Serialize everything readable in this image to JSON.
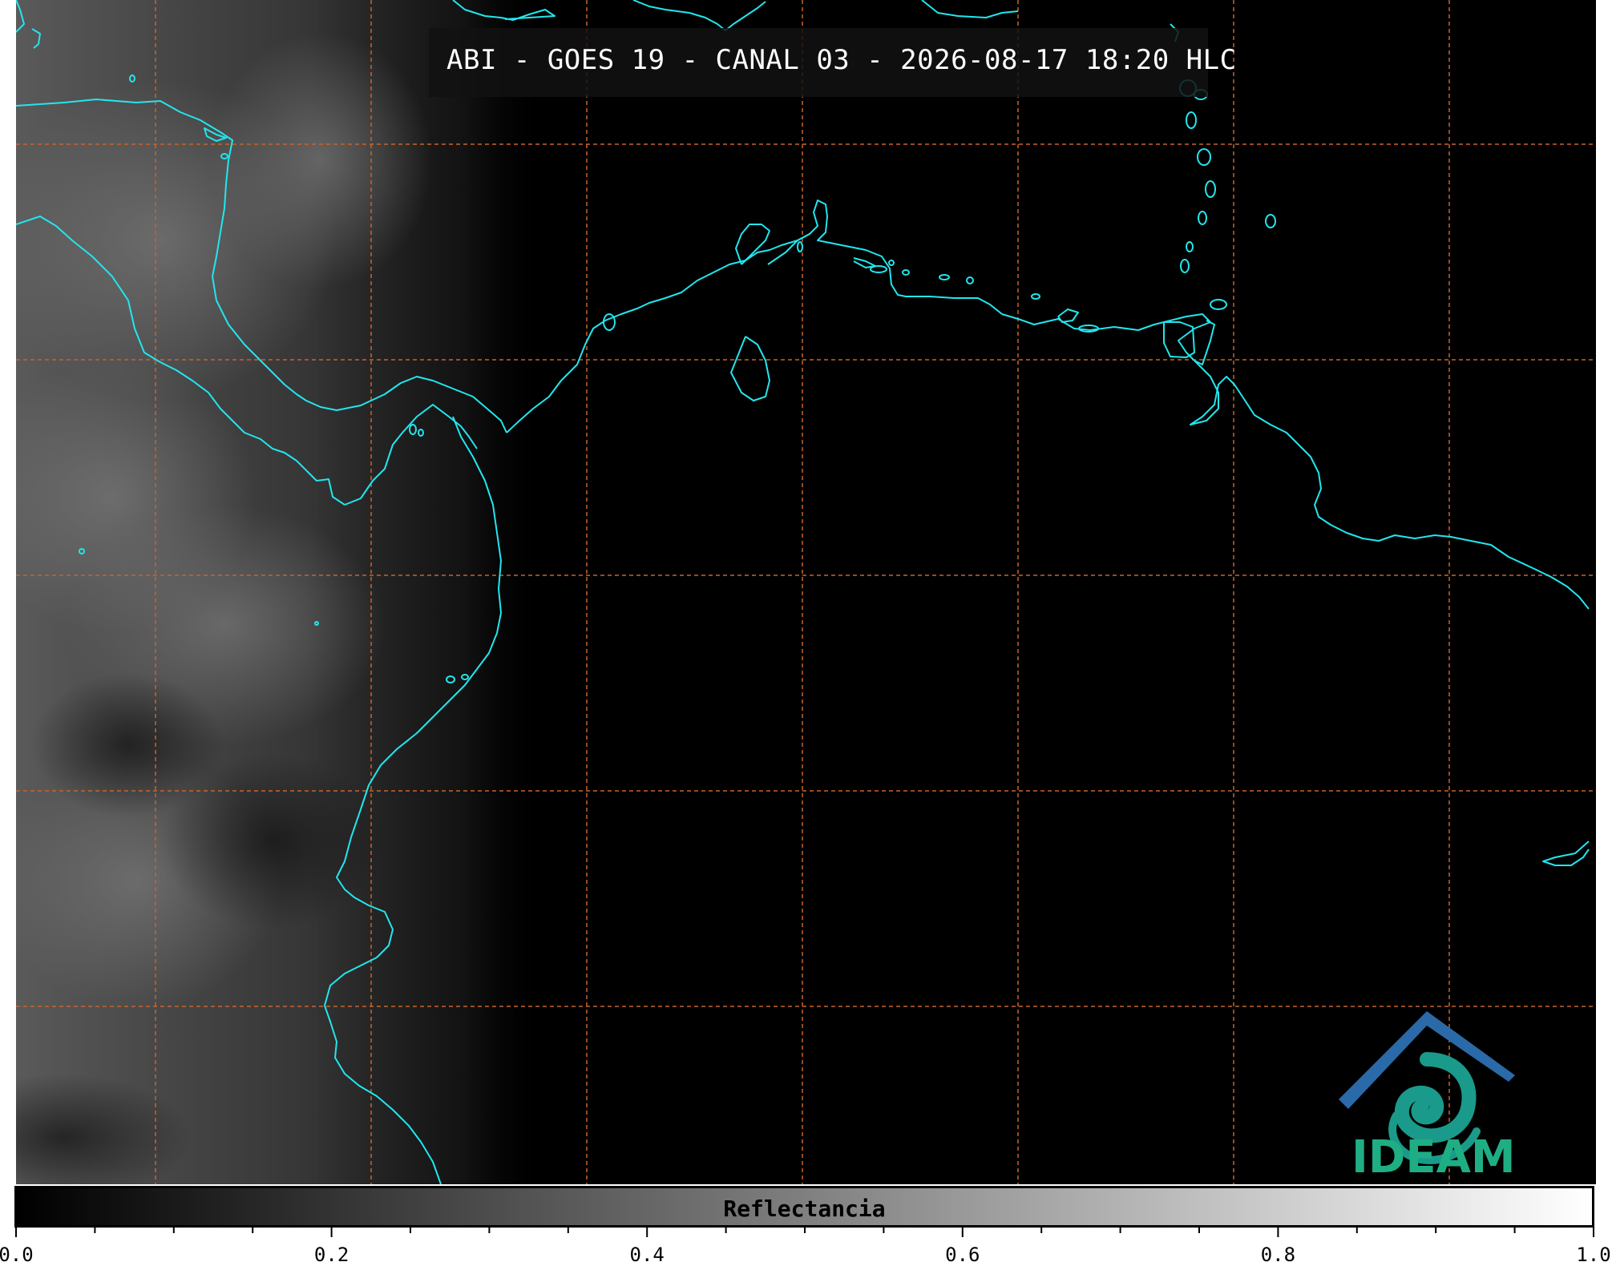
{
  "title": "ABI - GOES 19 - CANAL 03 - 2026-08-17 18:20 HLC",
  "colorbar": {
    "label": "Reflectancia",
    "min": 0.0,
    "max": 1.0,
    "tick_labels": [
      "0.0",
      "0.2",
      "0.4",
      "0.6",
      "0.8",
      "1.0"
    ],
    "colormap": [
      "#000000",
      "#ffffff"
    ]
  },
  "logo": {
    "text": "IDEAM",
    "text_color": "#1fae84",
    "roof_color": "#2a6aa8",
    "swirl_color": "#1a9a8a"
  },
  "map": {
    "background": "#000000",
    "coastline_color": "#22e6ee",
    "graticule_color": "#c8642a",
    "cloud_region": "west"
  }
}
